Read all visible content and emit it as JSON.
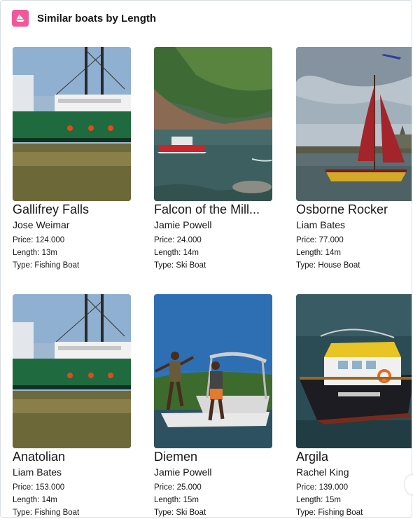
{
  "header": {
    "title": "Similar boats by Length",
    "icon": "boat-icon",
    "icon_color": "#f2579a"
  },
  "boats": [
    {
      "name": "Gallifrey Falls",
      "owner": "Jose Weimar",
      "price": "Price: 124.000",
      "length": "Length: 13m",
      "type": "Type: Fishing Boat",
      "image": "green-fishing-boat"
    },
    {
      "name": "Falcon of the Mill...",
      "owner": "Jamie Powell",
      "price": "Price: 24.000",
      "length": "Length: 14m",
      "type": "Type: Ski Boat",
      "image": "speedboat-on-river"
    },
    {
      "name": "Osborne Rocker",
      "owner": "Liam Bates",
      "price": "Price: 77.000",
      "length": "Length: 14m",
      "type": "Type: House Boat",
      "image": "red-sail-boat"
    },
    {
      "name": "Anatolian",
      "owner": "Liam Bates",
      "price": "Price: 153.000",
      "length": "Length: 14m",
      "type": "Type: Fishing Boat",
      "image": "green-fishing-boat"
    },
    {
      "name": "Diemen",
      "owner": "Jamie Powell",
      "price": "Price: 25.000",
      "length": "Length: 15m",
      "type": "Type: Ski Boat",
      "image": "ski-boat-jumpers"
    },
    {
      "name": "Argila",
      "owner": "Rachel King",
      "price": "Price: 139.000",
      "length": "Length: 15m",
      "type": "Type: Fishing Boat",
      "image": "dark-fishing-boat"
    }
  ]
}
